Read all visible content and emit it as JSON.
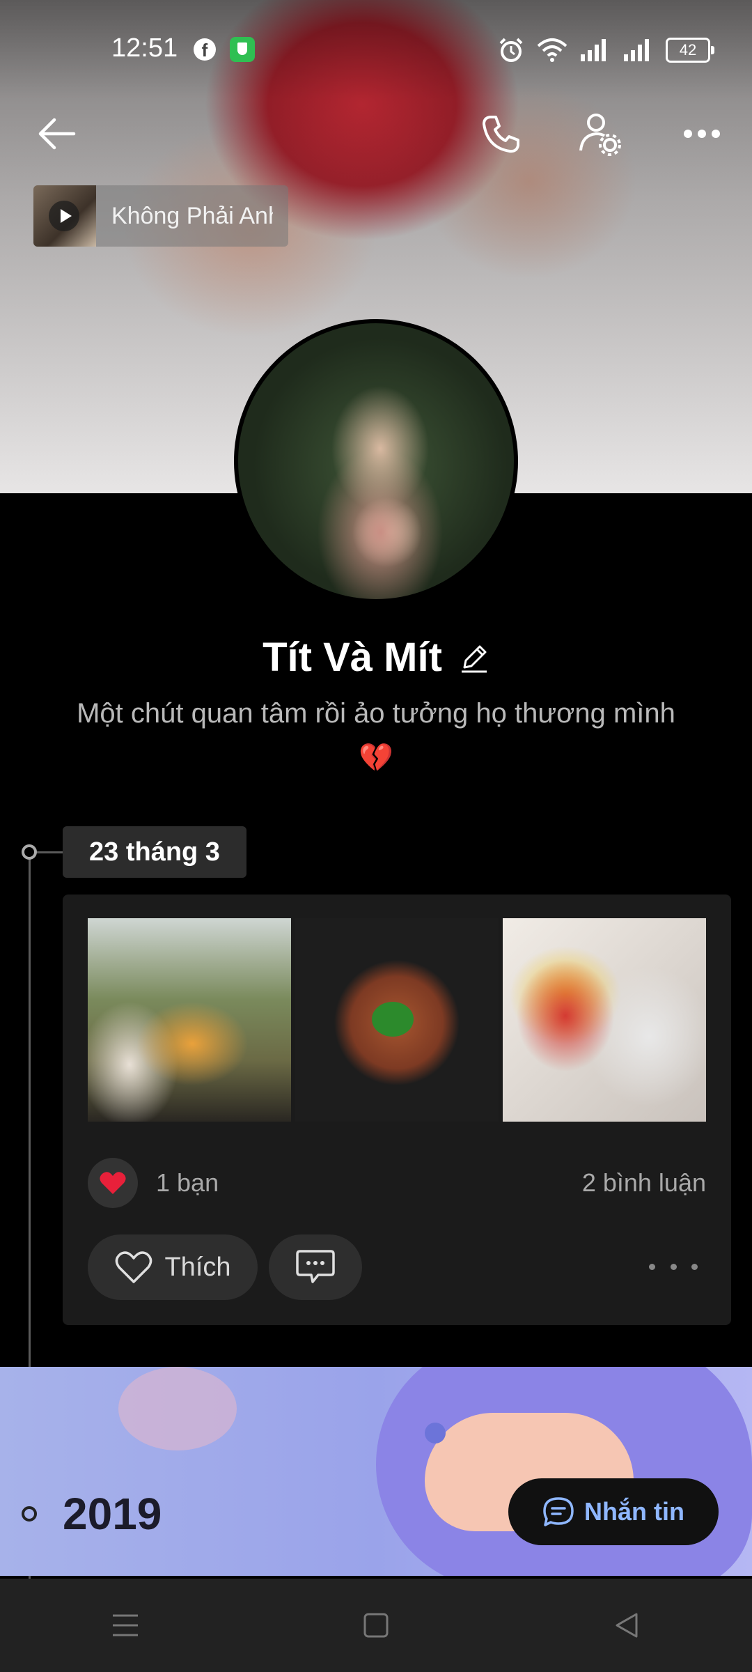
{
  "status_bar": {
    "time": "12:51",
    "battery": "42",
    "icons": [
      "facebook-icon",
      "shield-icon",
      "alarm-icon",
      "wifi-icon",
      "signal-icon",
      "signal-icon",
      "battery-icon"
    ]
  },
  "top_nav": {
    "icons": [
      "back-arrow-icon",
      "phone-icon",
      "user-settings-icon",
      "more-icon"
    ]
  },
  "music": {
    "title": "Không Phải Anh"
  },
  "profile": {
    "name": "Tít Và Mít",
    "bio": "Một chút quan tâm rồi ảo tưởng họ thương mình",
    "bio_emoji": "💔"
  },
  "post": {
    "date": "23 tháng 3",
    "reaction_count": "1 bạn",
    "comment_count": "2 bình luận",
    "like_label": "Thích"
  },
  "timeline": {
    "year": "2019"
  },
  "message_button": {
    "label": "Nhắn tin"
  },
  "colors": {
    "accent": "#8fb7ff",
    "heart": "#e8203a",
    "background": "#000000",
    "card": "#1b1b1b"
  }
}
